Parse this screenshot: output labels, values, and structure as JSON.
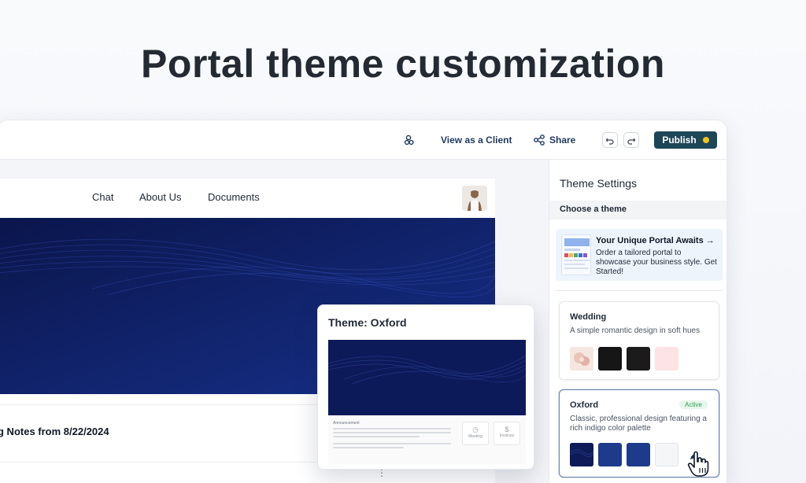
{
  "headline": "Portal theme customization",
  "topbar": {
    "view_as_client": "View as a Client",
    "share": "Share",
    "publish": "Publish"
  },
  "site": {
    "nav": [
      "Chat",
      "About Us",
      "Documents"
    ],
    "notes_title": "g Notes from 8/22/2024"
  },
  "preview_popup": {
    "title": "Theme: Oxford",
    "mini_heading": "Announcement",
    "mini_card_1": "Meeting",
    "mini_card_2": "Invoices"
  },
  "panel": {
    "title": "Theme Settings",
    "choose_label": "Choose a theme",
    "promo": {
      "title": "Your Unique Portal Awaits →",
      "description": "Order a tailored portal to showcase your business style. Get Started!"
    },
    "themes": [
      {
        "name": "Wedding",
        "description": "A simple romantic design in soft hues",
        "active": false,
        "swatches": [
          "#f3d9d3",
          "#161616",
          "#1b1b1b",
          "#fde3e4"
        ]
      },
      {
        "name": "Oxford",
        "description": "Classic, professional design featuring a rich indigo color palette",
        "active": true,
        "badge": "Active",
        "swatches": [
          "#0f1c5c",
          "#1e3a8a",
          "#1e3a8a",
          "#f4f6f8"
        ]
      }
    ]
  },
  "colors": {
    "publish_bg": "#1d4758",
    "publish_dot": "#f4c21c",
    "hero_bg": "#0d1a5a",
    "active_badge_text": "#2f9e52"
  }
}
